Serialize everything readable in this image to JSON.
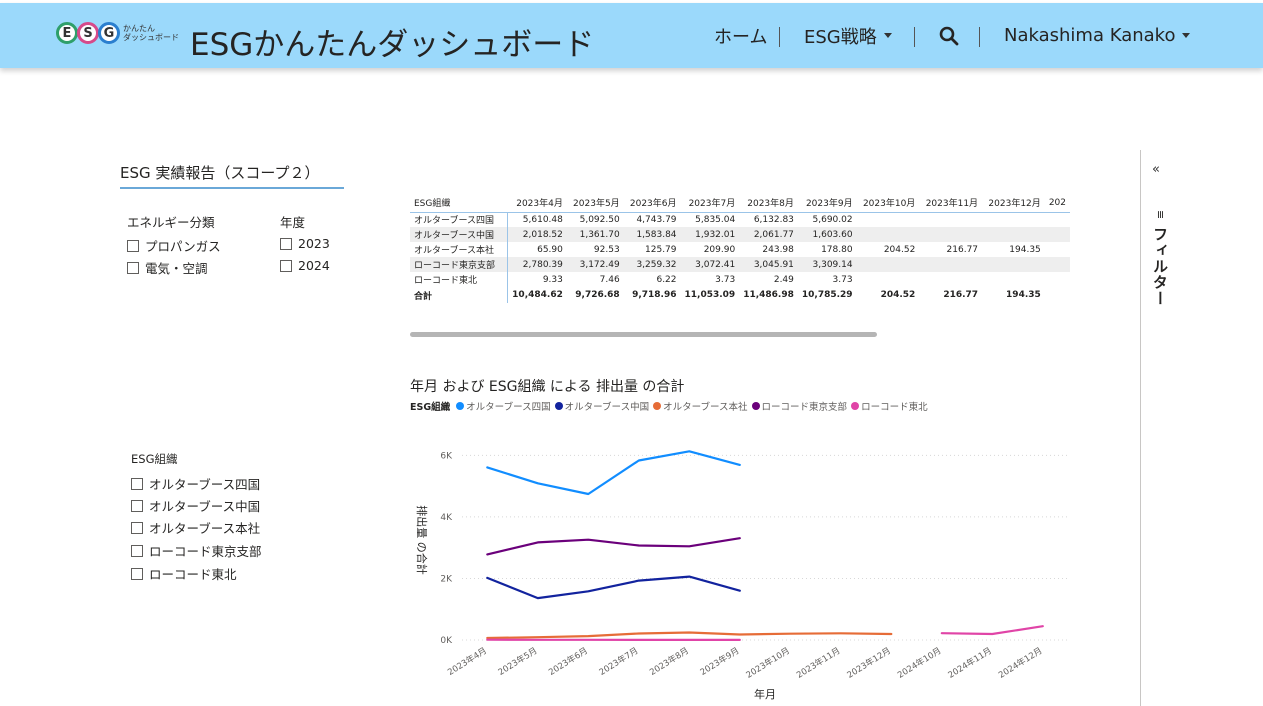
{
  "header": {
    "logo_letters": [
      "E",
      "S",
      "G"
    ],
    "logo_colors": [
      "#2e9f6a",
      "#d64a8a",
      "#2a7fcf"
    ],
    "logo_sub_line1": "かんたん",
    "logo_sub_line2": "ダッシュボード",
    "app_title": "ESGかんたんダッシュボード",
    "nav_home": "ホーム",
    "nav_strategy": "ESG戦略",
    "nav_user": "Nakashima Kanako"
  },
  "report": {
    "title": "ESG 実績報告（スコープ２）"
  },
  "slicers": {
    "energy": {
      "label": "エネルギー分類",
      "options": [
        "プロパンガス",
        "電気・空調"
      ]
    },
    "year": {
      "label": "年度",
      "options": [
        "2023",
        "2024"
      ]
    },
    "org": {
      "label": "ESG組織",
      "options": [
        "オルターブース四国",
        "オルターブース中国",
        "オルターブース本社",
        "ローコード東京支部",
        "ローコード東北"
      ]
    }
  },
  "table": {
    "row_header": "ESG組織",
    "columns": [
      "2023年4月",
      "2023年5月",
      "2023年6月",
      "2023年7月",
      "2023年8月",
      "2023年9月",
      "2023年10月",
      "2023年11月",
      "2023年12月",
      "202"
    ],
    "rows": [
      {
        "name": "オルターブース四国",
        "values": [
          "5,610.48",
          "5,092.50",
          "4,743.79",
          "5,835.04",
          "6,132.83",
          "5,690.02",
          "",
          "",
          "",
          ""
        ]
      },
      {
        "name": "オルターブース中国",
        "values": [
          "2,018.52",
          "1,361.70",
          "1,583.84",
          "1,932.01",
          "2,061.77",
          "1,603.60",
          "",
          "",
          "",
          ""
        ]
      },
      {
        "name": "オルターブース本社",
        "values": [
          "65.90",
          "92.53",
          "125.79",
          "209.90",
          "243.98",
          "178.80",
          "204.52",
          "216.77",
          "194.35",
          ""
        ]
      },
      {
        "name": "ローコード東京支部",
        "values": [
          "2,780.39",
          "3,172.49",
          "3,259.32",
          "3,072.41",
          "3,045.91",
          "3,309.14",
          "",
          "",
          "",
          ""
        ]
      },
      {
        "name": "ローコード東北",
        "values": [
          "9.33",
          "7.46",
          "6.22",
          "3.73",
          "2.49",
          "3.73",
          "",
          "",
          "",
          ""
        ]
      }
    ],
    "total": {
      "name": "合計",
      "values": [
        "10,484.62",
        "9,726.68",
        "9,718.96",
        "11,053.09",
        "11,486.98",
        "10,785.29",
        "204.52",
        "216.77",
        "194.35",
        ""
      ]
    }
  },
  "filter_pane": {
    "collapse_glyph": "«",
    "label": "フィルター"
  },
  "chart_data": {
    "type": "line",
    "title": "年月 および ESG組織 による 排出量 の合計",
    "legend_label": "ESG組織",
    "legend_position": "top-left",
    "xlabel": "年月",
    "ylabel": "排出量 の合計",
    "ylim": [
      0,
      6500
    ],
    "yticks": [
      0,
      2000,
      4000,
      6000
    ],
    "ytick_labels": [
      "0K",
      "2K",
      "4K",
      "6K"
    ],
    "grid": true,
    "categories": [
      "2023年4月",
      "2023年5月",
      "2023年6月",
      "2023年7月",
      "2023年8月",
      "2023年9月",
      "2023年10月",
      "2023年11月",
      "2023年12月",
      "2024年10月",
      "2024年11月",
      "2024年12月"
    ],
    "series": [
      {
        "name": "オルターブース四国",
        "color": "#118dff",
        "values": [
          5610.48,
          5092.5,
          4743.79,
          5835.04,
          6132.83,
          5690.02,
          null,
          null,
          null,
          null,
          null,
          null
        ]
      },
      {
        "name": "オルターブース中国",
        "color": "#12239e",
        "values": [
          2018.52,
          1361.7,
          1583.84,
          1932.01,
          2061.77,
          1603.6,
          null,
          null,
          null,
          null,
          null,
          null
        ]
      },
      {
        "name": "オルターブース本社",
        "color": "#e66c37",
        "values": [
          65.9,
          92.53,
          125.79,
          209.9,
          243.98,
          178.8,
          204.52,
          216.77,
          194.35,
          null,
          null,
          null
        ]
      },
      {
        "name": "ローコード東京支部",
        "color": "#6b007b",
        "values": [
          2780.39,
          3172.49,
          3259.32,
          3072.41,
          3045.91,
          3309.14,
          null,
          null,
          null,
          null,
          null,
          null
        ]
      },
      {
        "name": "ローコード東北",
        "color": "#e044a7",
        "values": [
          9.33,
          7.46,
          6.22,
          3.73,
          2.49,
          3.73,
          null,
          null,
          null,
          220,
          195,
          450
        ]
      }
    ]
  }
}
